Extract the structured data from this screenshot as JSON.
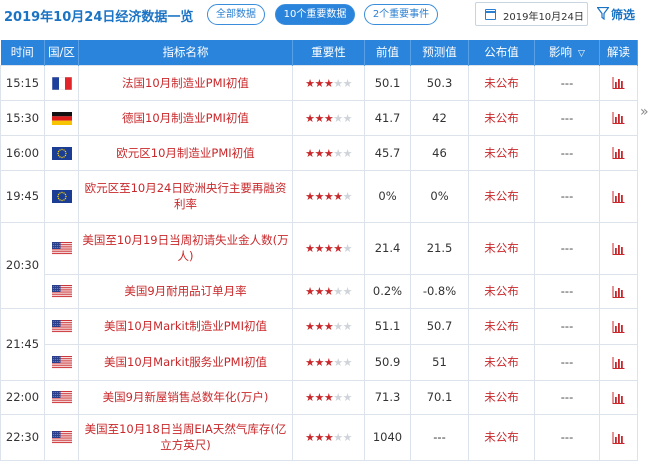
{
  "header": {
    "title": "2019年10月24日经济数据一览",
    "filters": [
      {
        "label": "全部数据",
        "active": false
      },
      {
        "label": "10个重要数据",
        "active": true
      },
      {
        "label": "2个重要事件",
        "active": false
      }
    ],
    "date": "2019年10月24日",
    "filter_label": "筛选"
  },
  "colors": {
    "accent": "#2a84dc",
    "highlight": "#c8282b",
    "star_off": "#cfd4da"
  },
  "table": {
    "columns": [
      "时间",
      "国/区",
      "指标名称",
      "重要性",
      "前值",
      "预测值",
      "公布值",
      "影响",
      "解读"
    ],
    "impact_icon": "chevron-down-icon",
    "rows": [
      {
        "time": "15:15",
        "region": "france",
        "name": "法国10月制造业PMI初值",
        "stars": 3,
        "prev": "50.1",
        "forecast": "50.3",
        "actual": "未公布",
        "impact": "---"
      },
      {
        "time": "15:30",
        "region": "germany",
        "name": "德国10月制造业PMI初值",
        "stars": 3,
        "prev": "41.7",
        "forecast": "42",
        "actual": "未公布",
        "impact": "---"
      },
      {
        "time": "16:00",
        "region": "eu",
        "name": "欧元区10月制造业PMI初值",
        "stars": 3,
        "prev": "45.7",
        "forecast": "46",
        "actual": "未公布",
        "impact": "---"
      },
      {
        "time": "19:45",
        "region": "eu",
        "name": "欧元区至10月24日欧洲央行主要再融资利率",
        "stars": 4,
        "prev": "0%",
        "forecast": "0%",
        "actual": "未公布",
        "impact": "---"
      },
      {
        "time": "20:30",
        "region": "usa",
        "name": "美国至10月19日当周初请失业金人数(万人)",
        "stars": 4,
        "prev": "21.4",
        "forecast": "21.5",
        "actual": "未公布",
        "impact": "---"
      },
      {
        "time": "",
        "region": "usa",
        "name": "美国9月耐用品订单月率",
        "stars": 3,
        "prev": "0.2%",
        "forecast": "-0.8%",
        "actual": "未公布",
        "impact": "---"
      },
      {
        "time": "21:45",
        "region": "usa",
        "name": "美国10月Markit制造业PMI初值",
        "stars": 3,
        "prev": "51.1",
        "forecast": "50.7",
        "actual": "未公布",
        "impact": "---"
      },
      {
        "time": "",
        "region": "usa",
        "name": "美国10月Markit服务业PMI初值",
        "stars": 3,
        "prev": "50.9",
        "forecast": "51",
        "actual": "未公布",
        "impact": "---"
      },
      {
        "time": "22:00",
        "region": "usa",
        "name": "美国9月新屋销售总数年化(万户)",
        "stars": 3,
        "prev": "71.3",
        "forecast": "70.1",
        "actual": "未公布",
        "impact": "---"
      },
      {
        "time": "22:30",
        "region": "usa",
        "name": "美国至10月18日当周EIA天然气库存(亿立方英尺)",
        "stars": 3,
        "prev": "1040",
        "forecast": "---",
        "actual": "未公布",
        "impact": "---"
      }
    ]
  }
}
